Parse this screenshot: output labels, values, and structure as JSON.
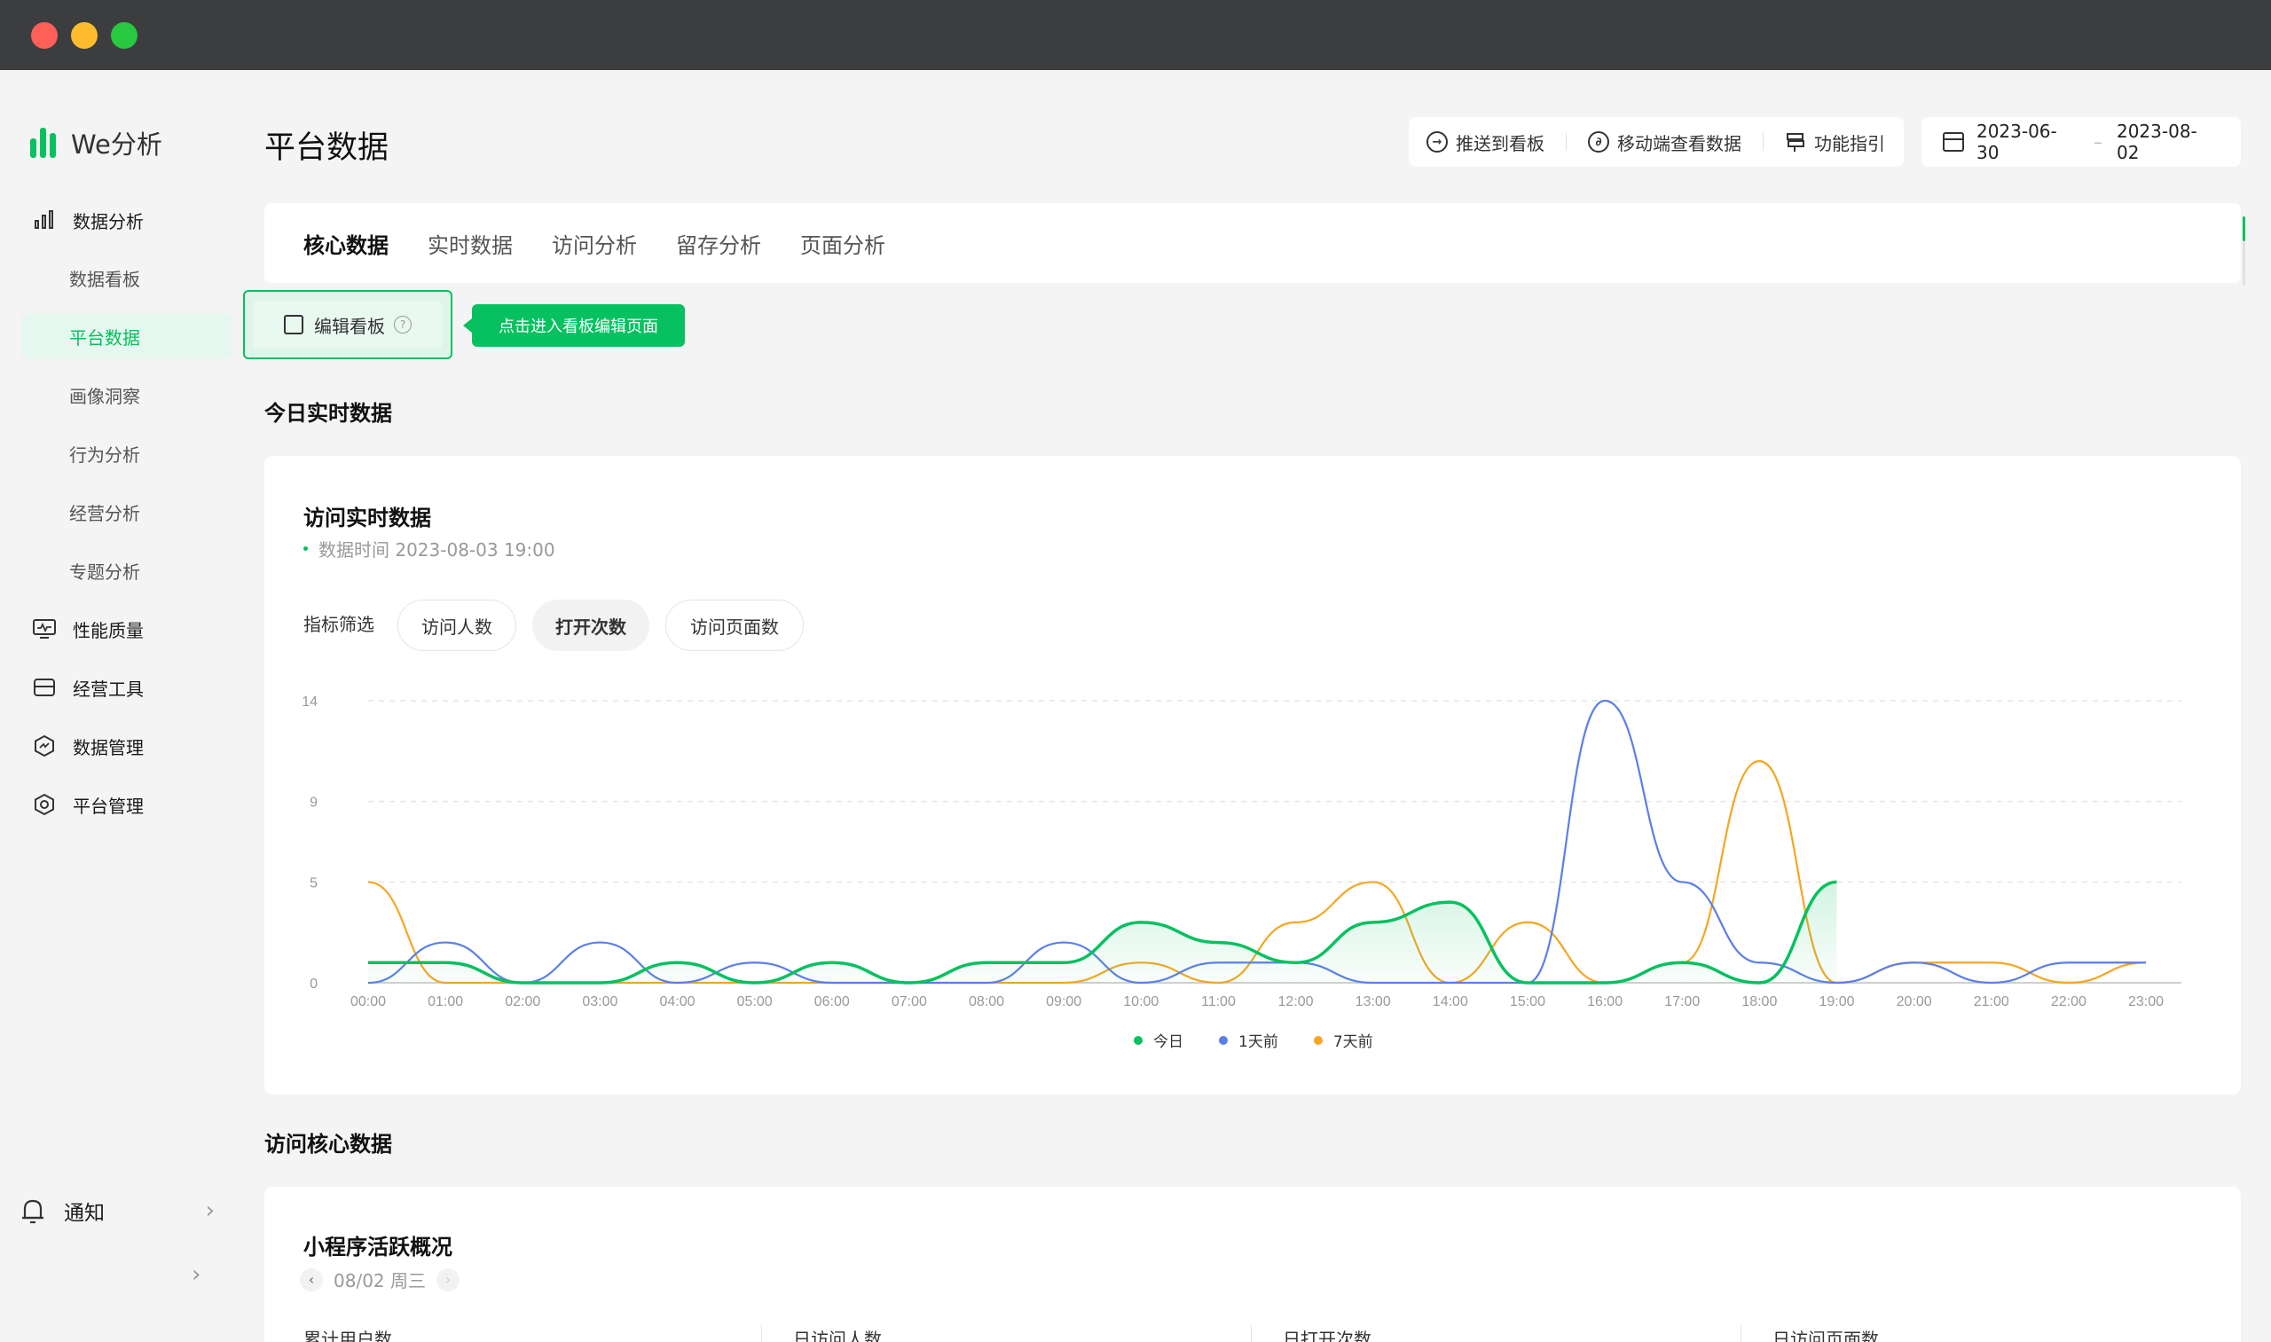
{
  "app": {
    "name": "We分析"
  },
  "sidebar": {
    "sections": [
      {
        "label": "数据分析",
        "icon": "bar-chart-icon"
      },
      {
        "label": "性能质量",
        "icon": "monitor-icon"
      },
      {
        "label": "经营工具",
        "icon": "store-icon"
      },
      {
        "label": "数据管理",
        "icon": "hexagon-icon"
      },
      {
        "label": "平台管理",
        "icon": "settings-hexagon-icon"
      }
    ],
    "sub_items": [
      "数据看板",
      "平台数据",
      "画像洞察",
      "行为分析",
      "经营分析",
      "专题分析"
    ],
    "active_sub": "平台数据",
    "notify_label": "通知"
  },
  "header": {
    "title": "平台数据",
    "actions": [
      "推送到看板",
      "移动端查看数据",
      "功能指引"
    ],
    "date_start": "2023-06-30",
    "date_sep": "–",
    "date_end": "2023-08-02"
  },
  "tabs": [
    "核心数据",
    "实时数据",
    "访问分析",
    "留存分析",
    "页面分析"
  ],
  "active_tab": "核心数据",
  "edit_board": {
    "label": "编辑看板",
    "help": "?",
    "tip": "点击进入看板编辑页面"
  },
  "section_realtime": "今日实时数据",
  "realtime_card": {
    "title": "访问实时数据",
    "subtitle": "数据时间 2023-08-03 19:00",
    "filter_label": "指标筛选",
    "filters": [
      "访问人数",
      "打开次数",
      "访问页面数"
    ],
    "active_filter": "打开次数"
  },
  "chart_data": {
    "type": "line",
    "x": [
      "00:00",
      "01:00",
      "02:00",
      "03:00",
      "04:00",
      "05:00",
      "06:00",
      "07:00",
      "08:00",
      "09:00",
      "10:00",
      "11:00",
      "12:00",
      "13:00",
      "14:00",
      "15:00",
      "16:00",
      "17:00",
      "18:00",
      "19:00",
      "20:00",
      "21:00",
      "22:00",
      "23:00"
    ],
    "y_ticks": [
      0,
      5,
      9,
      14
    ],
    "ylim": [
      0,
      14
    ],
    "grid": true,
    "legend_position": "bottom",
    "series": [
      {
        "name": "今日",
        "color": "#07c160",
        "values": [
          1,
          1,
          0,
          0,
          1,
          0,
          1,
          0,
          1,
          1,
          3,
          2,
          1,
          3,
          4,
          0,
          0,
          1,
          0,
          5,
          null,
          null,
          null,
          null
        ]
      },
      {
        "name": "1天前",
        "color": "#5b7fe8",
        "values": [
          0,
          2,
          0,
          2,
          0,
          1,
          0,
          0,
          0,
          2,
          0,
          1,
          1,
          0,
          0,
          0,
          14,
          5,
          1,
          0,
          1,
          0,
          1,
          1
        ]
      },
      {
        "name": "7天前",
        "color": "#f5a623",
        "values": [
          5,
          0,
          0,
          0,
          0,
          0,
          0,
          0,
          0,
          0,
          1,
          0,
          3,
          5,
          0,
          3,
          0,
          1,
          11,
          0,
          1,
          1,
          0,
          1
        ]
      }
    ]
  },
  "section_core": "访问核心数据",
  "overview_card": {
    "title": "小程序活跃概况",
    "date": "08/02 周三",
    "metrics": [
      "累计用户数",
      "日访问人数",
      "日打开次数",
      "日访问页面数"
    ]
  }
}
